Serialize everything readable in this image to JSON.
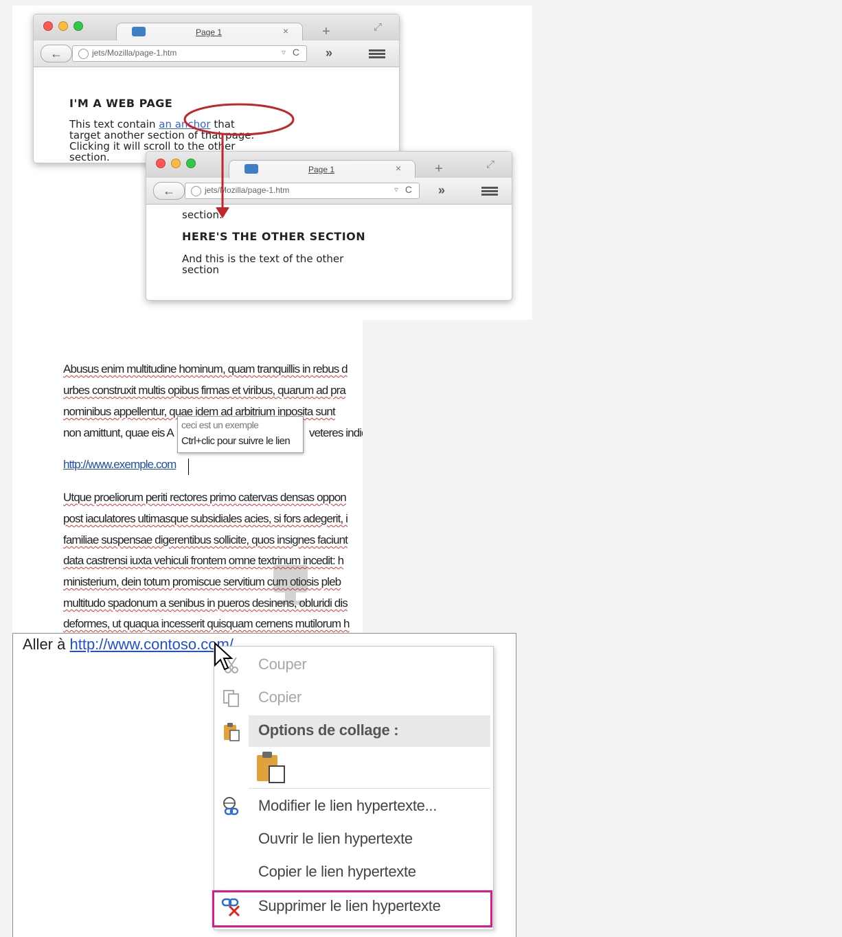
{
  "browser_top": {
    "tab_title": "Page 1",
    "tab_close": "×",
    "new_tab": "+",
    "url": "jets/Mozilla/page-1.htm",
    "back": "←",
    "reload": "C",
    "overflow": "»",
    "heading": "I'M A WEB PAGE",
    "para_before_link": "This text contain",
    "link_text": "an anchor",
    "para_after_link": "that",
    "para_line2": "target another section of that page.",
    "para_line3": "Clicking it will scroll to the other",
    "para_line4": "section."
  },
  "browser_bottom": {
    "tab_title": "Page 1",
    "tab_close": "×",
    "new_tab": "+",
    "url": "jets/Mozilla/page-1.htm",
    "back": "←",
    "reload": "C",
    "overflow": "»",
    "scrolled_text": "section.",
    "heading": "HERE'S THE OTHER SECTION",
    "para_line1": "And this is the text of the other",
    "para_line2": "section"
  },
  "document": {
    "lines": [
      "Abusus enim multitudine hominum, quam tranquillis in rebus d",
      "urbes construxit multis opibus firmas et viribus, quarum ad pra",
      "nominibus appellentur, quae idem ad arbitrium inposita sunt",
      "non amittunt, quae eis A",
      "veteres indid"
    ],
    "link": "http://www.exemple.com",
    "tooltip_line1": "ceci est un exemple",
    "tooltip_line2": "Ctrl+clic pour suivre le lien",
    "lines2": [
      "Utque proeliorum periti rectores primo catervas densas oppon",
      "post iaculatores ultimasque subsidiales acies, si fors adegerit, i",
      "familiae suspensae digerentibus sollicite, quos insignes faciunt",
      "data castrensi iuxta vehiculi frontem omne textrinum incedit: h",
      "ministerium, dein totum promiscue servitium cum otiosis pleb",
      "multitudo spadonum a senibus in pueros desinens, obluridi dis",
      "deformes, ut quaqua incesserit quisquam cernens mutilorum h"
    ]
  },
  "context": {
    "goto_prefix": "Aller à",
    "goto_link": "http://www.contoso.com/",
    "menu": {
      "cut": "Couper",
      "copy": "Copier",
      "paste_options": "Options de collage :",
      "edit_link": "Modifier le lien hypertexte...",
      "open_link": "Ouvrir le lien hypertexte",
      "copy_link": "Copier le lien hypertexte",
      "remove_link": "Supprimer le lien hypertexte"
    },
    "colors": {
      "highlight": "#e0198a",
      "link": "#1f4fd6",
      "arrow": "#c0262c"
    }
  }
}
